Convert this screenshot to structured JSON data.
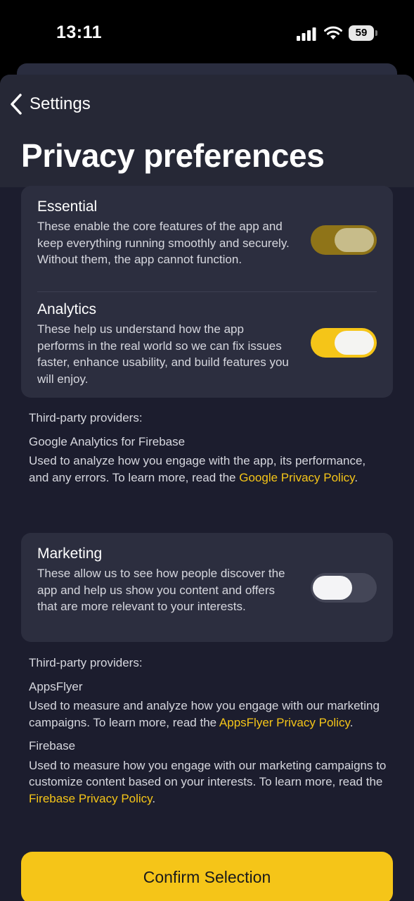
{
  "status_bar": {
    "time": "13:11",
    "battery": "59",
    "icons": [
      "cellular-signal-icon",
      "wifi-icon",
      "battery-icon"
    ]
  },
  "nav": {
    "back_label": "Settings",
    "back_icon": "chevron-left-icon"
  },
  "page": {
    "title": "Privacy preferences"
  },
  "sections": {
    "essential": {
      "title": "Essential",
      "description": "These enable the core features of the app and keep everything running smoothly and securely. Without them, the app cannot function.",
      "enabled": true,
      "locked": true
    },
    "analytics": {
      "title": "Analytics",
      "description": "These help us understand how the app performs in the real world so we can fix issues faster, enhance usability, and build features you will enjoy.",
      "enabled": true
    },
    "analytics_providers": {
      "heading": "Third-party providers:",
      "provider_name": "Google Analytics for Firebase",
      "text": "Used to analyze how you engage with the app, its performance, and any errors. To learn more, read the ",
      "link": "Google Privacy Policy",
      "after_link": "."
    },
    "marketing": {
      "title": "Marketing",
      "description": "These allow us to see how people discover the app and help us show you content and offers that are more relevant to your interests.",
      "enabled": false
    },
    "marketing_providers": {
      "heading": "Third-party providers:",
      "appsflyer": {
        "name": "AppsFlyer",
        "text": "Used to measure and analyze how you engage with our marketing campaigns. To learn more, read the ",
        "link": "AppsFlyer Privacy Policy",
        "after_link": "."
      },
      "firebase": {
        "name": "Firebase",
        "text": "Used to measure how you engage with our marketing campaigns to customize content based on your interests. To learn more, read the ",
        "link": "Firebase Privacy Policy",
        "after_link": "."
      }
    }
  },
  "actions": {
    "confirm_label": "Confirm Selection"
  },
  "colors": {
    "accent": "#f5c518",
    "background": "#1c1d2e",
    "card": "#2c2e3f"
  }
}
